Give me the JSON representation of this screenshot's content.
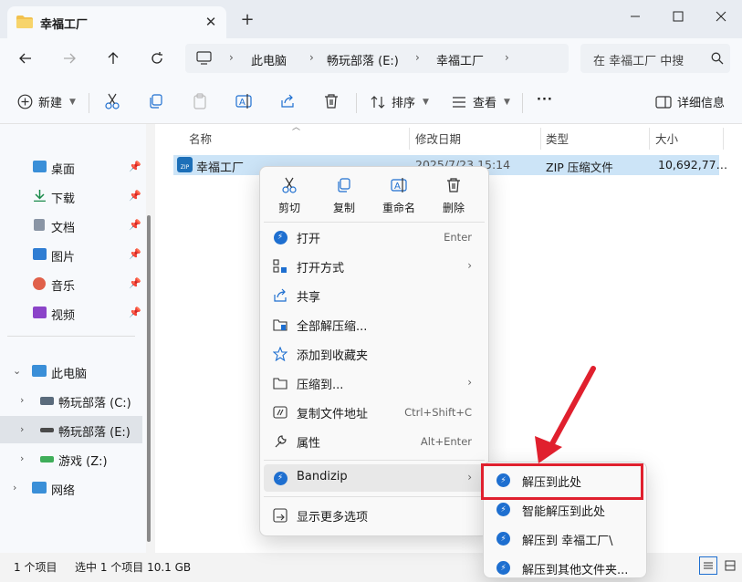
{
  "window": {
    "tab_title": "幸福工厂",
    "tab_close": "✕",
    "new_tab": "+"
  },
  "address": {
    "breadcrumbs": [
      "此电脑",
      "畅玩部落 (E:)",
      "幸福工厂"
    ],
    "search_placeholder": "在 幸福工厂 中搜"
  },
  "toolbar": {
    "new_label": "新建",
    "sort_label": "排序",
    "view_label": "查看",
    "more_label": "···",
    "details_label": "详细信息"
  },
  "sidebar": {
    "quick_access": [
      {
        "label": "桌面",
        "icon": "desktop-icon"
      },
      {
        "label": "下载",
        "icon": "download-icon"
      },
      {
        "label": "文档",
        "icon": "document-icon"
      },
      {
        "label": "图片",
        "icon": "picture-icon"
      },
      {
        "label": "音乐",
        "icon": "music-icon"
      },
      {
        "label": "视频",
        "icon": "video-icon"
      }
    ],
    "this_pc": "此电脑",
    "drives": [
      {
        "label": "畅玩部落 (C:)"
      },
      {
        "label": "畅玩部落 (E:)"
      },
      {
        "label": "游戏 (Z:)"
      }
    ],
    "network": "网络"
  },
  "file_list": {
    "columns": [
      "名称",
      "修改日期",
      "类型",
      "大小"
    ],
    "rows": [
      {
        "name": "幸福工厂",
        "date": "2025/7/23 15:14",
        "type": "ZIP 压缩文件",
        "size": "10,692,77…"
      }
    ]
  },
  "status": {
    "items": "1 个项目",
    "selected": "选中 1 个项目  10.1 GB"
  },
  "context_menu": {
    "quick_actions": [
      {
        "label": "剪切",
        "icon": "scissors-icon"
      },
      {
        "label": "复制",
        "icon": "copy-icon"
      },
      {
        "label": "重命名",
        "icon": "rename-icon"
      },
      {
        "label": "删除",
        "icon": "trash-icon"
      }
    ],
    "items": [
      {
        "label": "打开",
        "shortcut": "Enter",
        "icon": "bandizip-icon"
      },
      {
        "label": "打开方式",
        "shortcut": "",
        "icon": "open-with-icon",
        "submenu": true
      },
      {
        "label": "共享",
        "shortcut": "",
        "icon": "share-icon"
      },
      {
        "label": "全部解压缩...",
        "shortcut": "",
        "icon": "extract-all-icon"
      },
      {
        "label": "添加到收藏夹",
        "shortcut": "",
        "icon": "star-icon"
      },
      {
        "label": "压缩到...",
        "shortcut": "",
        "icon": "compress-icon",
        "submenu": true
      },
      {
        "label": "复制文件地址",
        "shortcut": "Ctrl+Shift+C",
        "icon": "copy-path-icon"
      },
      {
        "label": "属性",
        "shortcut": "Alt+Enter",
        "icon": "wrench-icon"
      },
      {
        "label": "Bandizip",
        "shortcut": "",
        "icon": "bandizip-icon",
        "submenu": true
      },
      {
        "label": "显示更多选项",
        "shortcut": "",
        "icon": "more-options-icon"
      }
    ]
  },
  "submenu": {
    "items": [
      {
        "label": "解压到此处"
      },
      {
        "label": "智能解压到此处"
      },
      {
        "label": "解压到 幸福工厂\\"
      },
      {
        "label": "解压到其他文件夹..."
      }
    ]
  },
  "colors": {
    "accent": "#1e6fd0",
    "selection": "#cce4f7",
    "highlight": "#e0202e"
  }
}
